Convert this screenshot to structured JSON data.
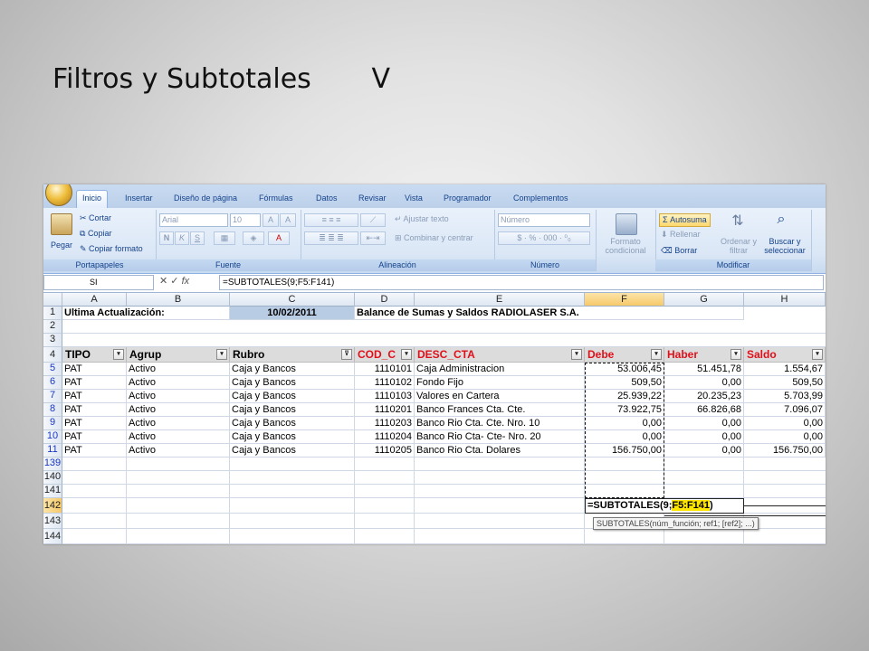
{
  "slide": {
    "title": "Filtros y Subtotales       V"
  },
  "ribbon": {
    "tabs": [
      "Inicio",
      "Insertar",
      "Diseño de página",
      "Fórmulas",
      "Datos",
      "Revisar",
      "Vista",
      "Programador",
      "Complementos"
    ],
    "clipboard": {
      "paste": "Pegar",
      "cut": "Cortar",
      "copy": "Copiar",
      "format_painter": "Copiar formato",
      "label": "Portapapeles"
    },
    "font": {
      "name": "Arial",
      "size": "10",
      "bold": "N",
      "italic": "K",
      "underline": "S",
      "label": "Fuente"
    },
    "alignment": {
      "wrap": "Ajustar texto",
      "merge": "Combinar y centrar",
      "label": "Alineación"
    },
    "number": {
      "format": "Número",
      "label": "Número"
    },
    "styles": {
      "conditional": "Formato condicional"
    },
    "editing": {
      "autosum": "Autosuma",
      "fill": "Rellenar",
      "clear": "Borrar",
      "sort": "Ordenar y filtrar",
      "find": "Buscar y seleccionar",
      "label": "Modificar"
    }
  },
  "formula_bar": {
    "name_box": "SI",
    "formula": "=SUBTOTALES(9;F5:F141)",
    "fx": "fx"
  },
  "sheet": {
    "columns": [
      "A",
      "B",
      "C",
      "D",
      "E",
      "F",
      "G",
      "H"
    ],
    "row1": {
      "label": "Ultima Actualización:",
      "date": "10/02/2011",
      "title": "Balance de Sumas y Saldos RADIOLASER S.A."
    },
    "headers": [
      "TIPO",
      "Agrup",
      "Rubro",
      "COD_C",
      "DESC_CTA",
      "Debe",
      "Haber",
      "Saldo"
    ],
    "rows": [
      {
        "num": "5",
        "tipo": "PAT",
        "agrup": "Activo",
        "rubro": "Caja y Bancos",
        "cod": "1110101",
        "desc": "Caja Administracion",
        "debe": "53.006,45",
        "haber": "51.451,78",
        "saldo": "1.554,67"
      },
      {
        "num": "6",
        "tipo": "PAT",
        "agrup": "Activo",
        "rubro": "Caja y Bancos",
        "cod": "1110102",
        "desc": "Fondo Fijo",
        "debe": "509,50",
        "haber": "0,00",
        "saldo": "509,50"
      },
      {
        "num": "7",
        "tipo": "PAT",
        "agrup": "Activo",
        "rubro": "Caja y Bancos",
        "cod": "1110103",
        "desc": "Valores en Cartera",
        "debe": "25.939,22",
        "haber": "20.235,23",
        "saldo": "5.703,99"
      },
      {
        "num": "8",
        "tipo": "PAT",
        "agrup": "Activo",
        "rubro": "Caja y Bancos",
        "cod": "1110201",
        "desc": "Banco Frances Cta. Cte.",
        "debe": "73.922,75",
        "haber": "66.826,68",
        "saldo": "7.096,07"
      },
      {
        "num": "9",
        "tipo": "PAT",
        "agrup": "Activo",
        "rubro": "Caja y Bancos",
        "cod": "1110203",
        "desc": "Banco Rio Cta. Cte. Nro. 10",
        "debe": "0,00",
        "haber": "0,00",
        "saldo": "0,00"
      },
      {
        "num": "10",
        "tipo": "PAT",
        "agrup": "Activo",
        "rubro": "Caja y Bancos",
        "cod": "1110204",
        "desc": "Banco Rio Cta- Cte- Nro. 20",
        "debe": "0,00",
        "haber": "0,00",
        "saldo": "0,00"
      },
      {
        "num": "11",
        "tipo": "PAT",
        "agrup": "Activo",
        "rubro": "Caja y Bancos",
        "cod": "1110205",
        "desc": "Banco Rio Cta. Dolares",
        "debe": "156.750,00",
        "haber": "0,00",
        "saldo": "156.750,00"
      }
    ],
    "row_numbers": [
      "1",
      "2",
      "3",
      "4",
      "139",
      "140",
      "141",
      "142",
      "143",
      "144"
    ],
    "edit": {
      "prefix": "=SUBTOTALES(9;",
      "range": "F5:F141",
      "suffix": ")"
    },
    "tooltip": "SUBTOTALES(núm_función; ref1; [ref2]; ...)"
  },
  "colors": {
    "header_red": "#e0101a",
    "date_fill": "#b8cce4",
    "range_highlight": "#ffe600"
  }
}
